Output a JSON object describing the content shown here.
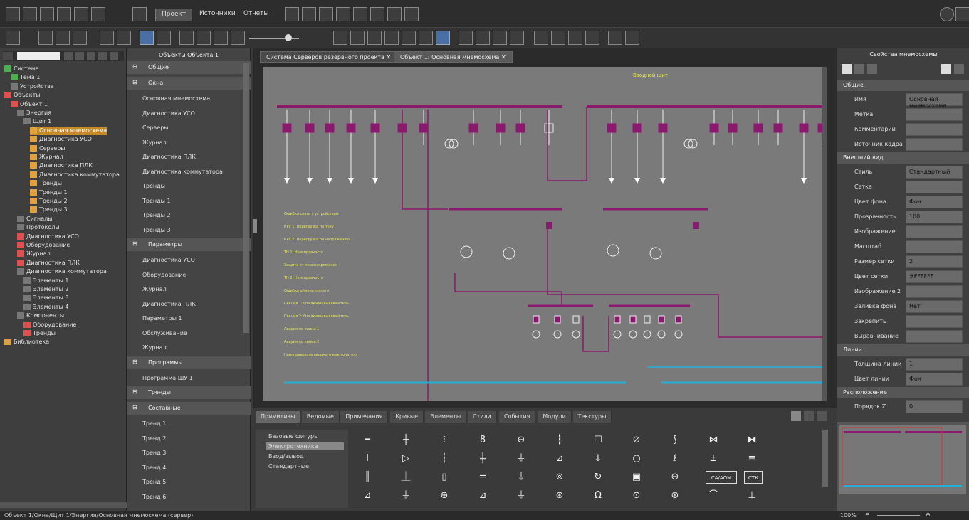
{
  "ribbon": {
    "tabs": [
      "Проект",
      "Источники",
      "Отчеты"
    ]
  },
  "tree": {
    "items": [
      {
        "label": "Система",
        "indent": 0,
        "color": "#4caf50"
      },
      {
        "label": "Тема 1",
        "indent": 1,
        "color": "#4caf50"
      },
      {
        "label": "Устройства",
        "indent": 1,
        "color": "#777"
      },
      {
        "label": "Объекты",
        "indent": 0,
        "color": "#e05050"
      },
      {
        "label": "Объект 1",
        "indent": 1,
        "color": "#e05050"
      },
      {
        "label": "Энергия",
        "indent": 2,
        "color": "#777"
      },
      {
        "label": "Щит 1",
        "indent": 3,
        "color": "#777"
      },
      {
        "label": "Основная мнемосхема",
        "indent": 4,
        "color": "#e0a040",
        "selected": true
      },
      {
        "label": "Диагностика УСО",
        "indent": 4,
        "color": "#e0a040"
      },
      {
        "label": "Серверы",
        "indent": 4,
        "color": "#e0a040"
      },
      {
        "label": "Журнал",
        "indent": 4,
        "color": "#e0a040"
      },
      {
        "label": "Диагностика ПЛК",
        "indent": 4,
        "color": "#e0a040"
      },
      {
        "label": "Диагностика коммутатора",
        "indent": 4,
        "color": "#e0a040"
      },
      {
        "label": "Тренды",
        "indent": 4,
        "color": "#e0a040"
      },
      {
        "label": "Тренды 1",
        "indent": 4,
        "color": "#e0a040"
      },
      {
        "label": "Тренды 2",
        "indent": 4,
        "color": "#e0a040"
      },
      {
        "label": "Тренды 3",
        "indent": 4,
        "color": "#e0a040"
      },
      {
        "label": "Сигналы",
        "indent": 2,
        "color": "#777"
      },
      {
        "label": "Протоколы",
        "indent": 2,
        "color": "#777"
      },
      {
        "label": "Диагностика УСО",
        "indent": 2,
        "color": "#e05050"
      },
      {
        "label": "Оборудование",
        "indent": 2,
        "color": "#e05050"
      },
      {
        "label": "Журнал",
        "indent": 2,
        "color": "#e05050"
      },
      {
        "label": "Диагностика ПЛК",
        "indent": 2,
        "color": "#e05050"
      },
      {
        "label": "Диагностика коммутатора",
        "indent": 2,
        "color": "#777"
      },
      {
        "label": "Элементы 1",
        "indent": 3,
        "color": "#777"
      },
      {
        "label": "Элементы 2",
        "indent": 3,
        "color": "#777"
      },
      {
        "label": "Элементы 3",
        "indent": 3,
        "color": "#777"
      },
      {
        "label": "Элементы 4",
        "indent": 3,
        "color": "#777"
      },
      {
        "label": "Компоненты",
        "indent": 2,
        "color": "#777"
      },
      {
        "label": "Оборудование",
        "indent": 3,
        "color": "#e05050"
      },
      {
        "label": "Тренды",
        "indent": 3,
        "color": "#e05050"
      },
      {
        "label": "Библиотека",
        "indent": 0,
        "color": "#e0a040"
      }
    ]
  },
  "objects": {
    "header": "Объекты Объекта 1",
    "sections": [
      {
        "title": "Общие",
        "items": []
      },
      {
        "title": "Окна",
        "items": [
          "Основная мнемосхема",
          "Диагностика УСО",
          "Серверы",
          "Журнал",
          "Диагностика ПЛК",
          "Диагностика коммутатора",
          "Тренды",
          "Тренды 1",
          "Тренды 2",
          "Тренды 3"
        ]
      },
      {
        "title": "Параметры",
        "items": [
          "Диагностика УСО",
          "Оборудование",
          "Журнал",
          "Диагностика ПЛК",
          "Параметры 1",
          "Обслуживание",
          "Журнал"
        ]
      },
      {
        "title": "Программы",
        "items": [
          "Программа ШУ 1"
        ]
      },
      {
        "title": "Тренды",
        "items": []
      },
      {
        "title": "Составные",
        "items": [
          "Тренд 1",
          "Тренд 2",
          "Тренд 3",
          "Тренд 4",
          "Тренд 5",
          "Тренд 6"
        ]
      }
    ]
  },
  "canvas": {
    "tabs": [
      "Система Серверов резервного проекта",
      "Объект 1: Основная мнемосхема"
    ],
    "title": "Вводной щит",
    "legend_rows": [
      "Ошибка связи с устройством",
      "КРУ 1: Перегрузка по току",
      "КРУ 2: Перегрузка по напряжению",
      "ТН 1: Неисправность",
      "Защита от перенапряжения",
      "ТН 2: Неисправность",
      "Ошибка обмена по сети",
      "Секция 1: Отключен выключатель",
      "Секция 2: Отключен выключатель",
      "Авария по линии 1",
      "Авария по линии 2",
      "Неисправность вводного выключателя"
    ]
  },
  "palette": {
    "tabs": [
      "Примитивы",
      "Ведомые",
      "Примечания",
      "Кривые",
      "Элементы",
      "Стили",
      "События",
      "Модули",
      "Текстуры"
    ],
    "groups": [
      "Базовые фигуры",
      "Электротехника",
      "Ввод/вывод",
      "Стандартные"
    ],
    "labeled_symbols": [
      "СА/АОМ",
      "СТК"
    ]
  },
  "properties": {
    "header": "Свойства мнемосхемы",
    "sections": [
      {
        "title": "Общие",
        "rows": [
          {
            "label": "Имя",
            "value": "Основная мнемосхема"
          },
          {
            "label": "Метка",
            "value": ""
          },
          {
            "label": "Комментарий",
            "value": ""
          },
          {
            "label": "Источник кадра",
            "value": ""
          }
        ]
      },
      {
        "title": "Внешний вид",
        "rows": [
          {
            "label": "Стиль",
            "value": "Стандартный"
          },
          {
            "label": "Сетка",
            "value": ""
          },
          {
            "label": "Цвет фона",
            "value": "Фон"
          },
          {
            "label": "Прозрачность",
            "value": "100"
          },
          {
            "label": "Изображение",
            "value": ""
          },
          {
            "label": "Масштаб",
            "value": ""
          },
          {
            "label": "Размер сетки",
            "value": "2"
          },
          {
            "label": "Цвет сетки",
            "value": "#FFFFFF"
          },
          {
            "label": "Изображение 2",
            "value": ""
          },
          {
            "label": "Заливка фона",
            "value": "Нет"
          },
          {
            "label": "Закрепить",
            "value": ""
          },
          {
            "label": "Выравнивание",
            "value": ""
          }
        ]
      },
      {
        "title": "Линии",
        "rows": [
          {
            "label": "Толщина линии",
            "value": "1"
          },
          {
            "label": "Цвет линии",
            "value": "Фон"
          }
        ]
      },
      {
        "title": "Расположение",
        "rows": [
          {
            "label": "Порядок Z",
            "value": "0"
          }
        ]
      }
    ]
  },
  "statusbar": {
    "path": "Объект 1/Окна/Щит 1/Энергия/Основная мнемосхема (сервер)",
    "zoom": "100%"
  },
  "colors": {
    "accent": "#2f8fd6",
    "bus": "#8a1a6e",
    "label": "#e8e85a",
    "cyan": "#22b0d6"
  }
}
